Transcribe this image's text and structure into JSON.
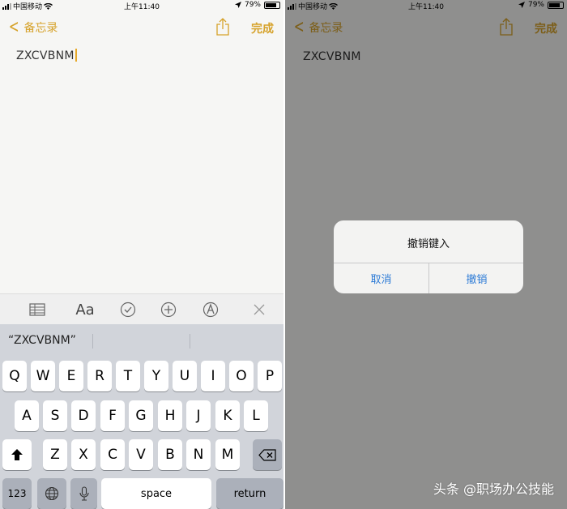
{
  "status": {
    "carrier": "中国移动",
    "time": "上午11:40",
    "battery": "79%"
  },
  "nav": {
    "back_label": "备忘录",
    "done_label": "完成"
  },
  "note": {
    "text": "ZXCVBNM"
  },
  "suggestions": [
    "“ZXCVBNM”"
  ],
  "toolbar": {
    "format_label": "Aa"
  },
  "keyboard": {
    "row1": [
      "Q",
      "W",
      "E",
      "R",
      "T",
      "Y",
      "U",
      "I",
      "O",
      "P"
    ],
    "row2": [
      "A",
      "S",
      "D",
      "F",
      "G",
      "H",
      "J",
      "K",
      "L"
    ],
    "row3": [
      "Z",
      "X",
      "C",
      "V",
      "B",
      "N",
      "M"
    ],
    "numbers_label": "123",
    "space_label": "space",
    "return_label": "return"
  },
  "alert": {
    "title": "撤销键入",
    "cancel_label": "取消",
    "undo_label": "撤销",
    "accent": "#2b7ad6"
  },
  "watermark": "头条 @职场办公技能",
  "colors": {
    "accent": "#d6a22a",
    "paper": "#f6f6f4",
    "keyboard_bg": "#d1d4da"
  }
}
